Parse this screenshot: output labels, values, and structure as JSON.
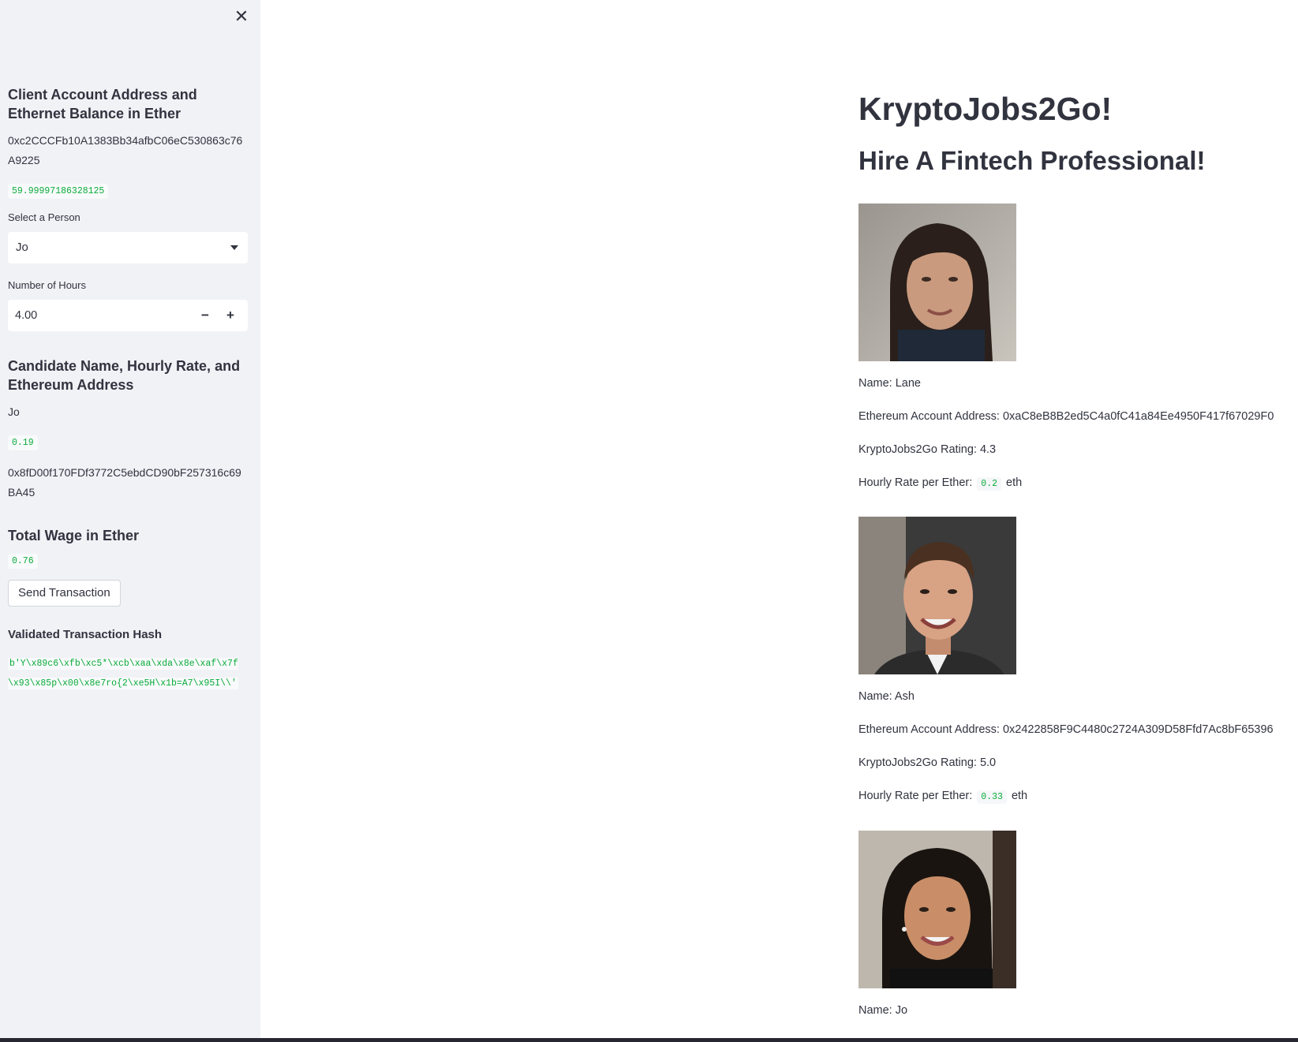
{
  "sidebar": {
    "close_glyph": "✕",
    "client_heading": "Client Account Address and Ethernet Balance in Ether",
    "client_address": "0xc2CCCFb10A1383Bb34afbC06eC530863c76A9225",
    "client_balance": "59.99997186328125",
    "select_label": "Select a Person",
    "select_value": "Jo",
    "hours_label": "Number of Hours",
    "hours_value": "4.00",
    "minus_glyph": "−",
    "plus_glyph": "+",
    "candidate_heading": "Candidate Name, Hourly Rate, and Ethereum Address",
    "candidate_name": "Jo",
    "candidate_rate": "0.19",
    "candidate_address": "0x8fD00f170FDf3772C5ebdCD90bF257316c69BA45",
    "wage_heading": "Total Wage in Ether",
    "wage_value": "0.76",
    "send_button": "Send Transaction",
    "hash_heading": "Validated Transaction Hash",
    "hash_value": "b'Y\\x89c6\\xfb\\xc5*\\xcb\\xaa\\xda\\x8e\\xaf\\x7f\\x93\\x85p\\x00\\x8e7ro{2\\xe5H\\x1b=A7\\x95I\\\\'"
  },
  "main": {
    "title": "KryptoJobs2Go!",
    "subtitle": "Hire A Fintech Professional!",
    "candidates": [
      {
        "name": "Name: Lane",
        "address": "Ethereum Account Address: 0xaC8eB8B2ed5C4a0fC41a84Ee4950F417f67029F0",
        "rating": "KryptoJobs2Go Rating: 4.3",
        "rate_label": "Hourly Rate per Ether:",
        "rate_value": "0.2",
        "rate_unit": "eth"
      },
      {
        "name": "Name: Ash",
        "address": "Ethereum Account Address: 0x2422858F9C4480c2724A309D58Ffd7Ac8bF65396",
        "rating": "KryptoJobs2Go Rating: 5.0",
        "rate_label": "Hourly Rate per Ether:",
        "rate_value": "0.33",
        "rate_unit": "eth"
      },
      {
        "name": "Name: Jo"
      }
    ]
  },
  "colors": {
    "sidebar_bg": "#f0f2f6",
    "text": "#31333f",
    "code_green": "#09ab3b"
  }
}
